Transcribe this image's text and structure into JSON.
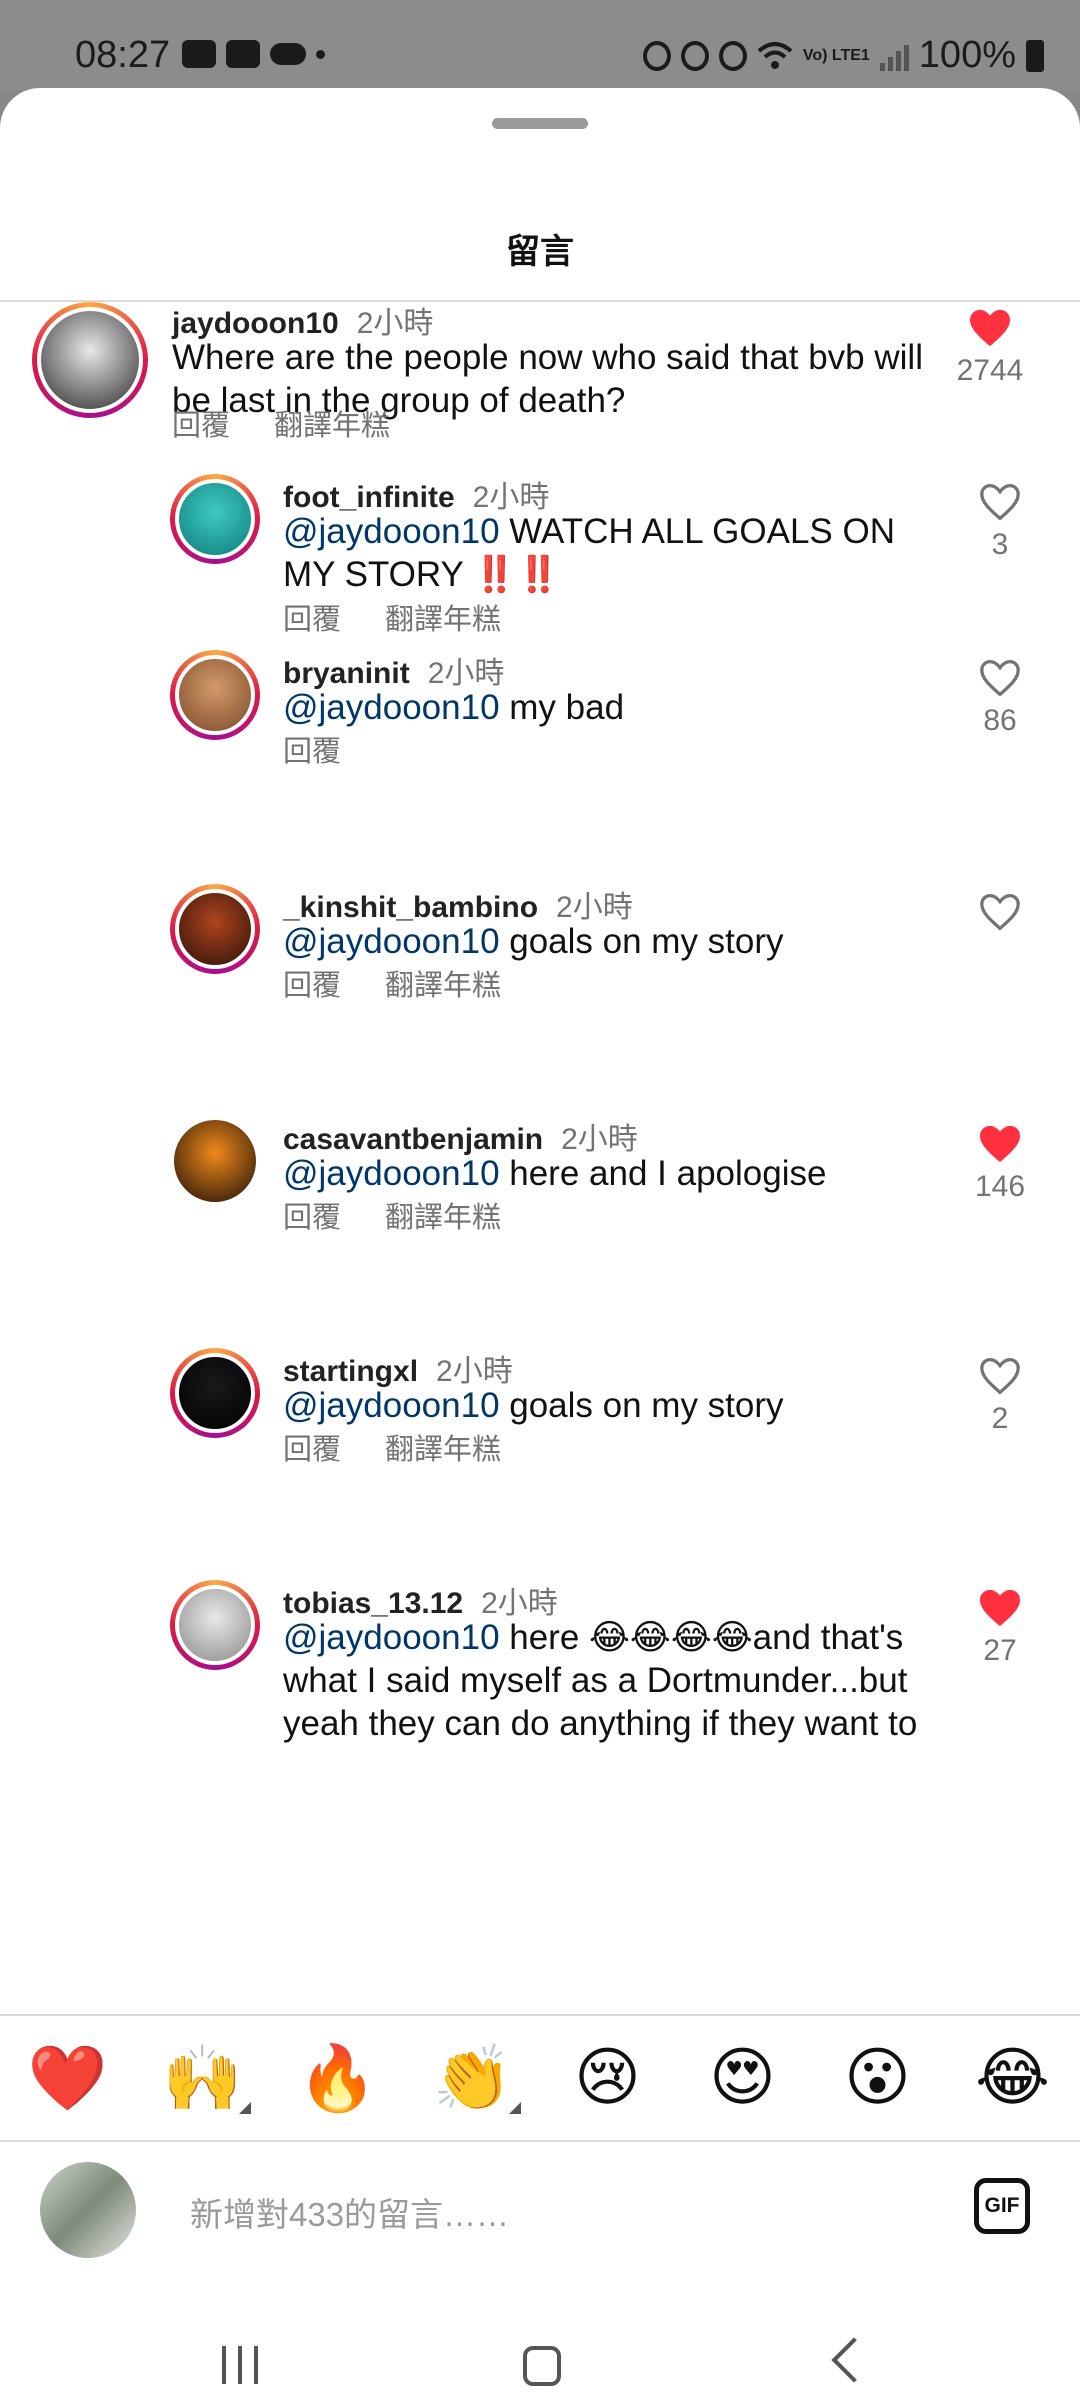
{
  "status_bar": {
    "time": "08:27",
    "battery": "100%",
    "network": "Vo) LTE1",
    "icons": [
      "youtube-icon",
      "game-icon",
      "cloud-icon",
      "dot-icon",
      "lock-icon",
      "alarm-icon",
      "mute-icon",
      "wifi-icon",
      "signal-icon",
      "battery-icon"
    ]
  },
  "sheet": {
    "title": "留言"
  },
  "comments": [
    {
      "username": "jaydooon10",
      "time": "2小時",
      "mention": "",
      "text": "Where are the people now who said that bvb will be last in the group of death?",
      "reply_label": "回覆",
      "translate_label": "翻譯年糕",
      "liked": true,
      "likes": "2744",
      "avatar_colors": [
        "#e8e8e8",
        "#2a2a2a"
      ]
    },
    {
      "username": "foot_infinite",
      "time": "2小時",
      "mention": "@jaydooon10",
      "text": " WATCH ALL GOALS ON MY STORY ‼️‼️",
      "reply_label": "回覆",
      "translate_label": "翻譯年糕",
      "liked": false,
      "likes": "3",
      "avatar_colors": [
        "#3ec9c4",
        "#0f7d7a"
      ]
    },
    {
      "username": "bryaninit",
      "time": "2小時",
      "mention": "@jaydooon10",
      "text": " my bad",
      "reply_label": "回覆",
      "translate_label": "",
      "liked": false,
      "likes": "86",
      "avatar_colors": [
        "#d49a6a",
        "#7a4a2a"
      ]
    },
    {
      "username": "_kinshit_bambino",
      "time": "2小時",
      "mention": "@jaydooon10",
      "text": " goals on my story",
      "reply_label": "回覆",
      "translate_label": "翻譯年糕",
      "liked": false,
      "likes": "",
      "avatar_colors": [
        "#b0441f",
        "#2a1208"
      ]
    },
    {
      "username": "casavantbenjamin",
      "time": "2小時",
      "mention": "@jaydooon10",
      "text": " here and I apologise",
      "reply_label": "回覆",
      "translate_label": "翻譯年糕",
      "liked": true,
      "likes": "146",
      "avatar_colors": [
        "#f08a1c",
        "#1a0d05"
      ]
    },
    {
      "username": "startingxl",
      "time": "2小時",
      "mention": "@jaydooon10",
      "text": " goals on my story",
      "reply_label": "回覆",
      "translate_label": "翻譯年糕",
      "liked": false,
      "likes": "2",
      "avatar_colors": [
        "#1a1a1a",
        "#000000"
      ]
    },
    {
      "username": "tobias_13.12",
      "time": "2小時",
      "mention": "@jaydooon10",
      "text": " here 😂😂😂😂and that's what I said myself as a Dortmunder...but yeah they can do anything if they want to",
      "reply_label": "",
      "translate_label": "",
      "liked": true,
      "likes": "27",
      "avatar_colors": [
        "#e9e9e9",
        "#8a8a8a"
      ]
    }
  ],
  "emoji_bar": [
    "❤️",
    "🙌",
    "🔥",
    "👏",
    "😢",
    "😍",
    "😮",
    "😂"
  ],
  "composer": {
    "placeholder": "新增對433的留言……",
    "gif_label": "GIF"
  },
  "colors": {
    "like_red": "#ff3040",
    "mention_blue": "#00376b"
  }
}
